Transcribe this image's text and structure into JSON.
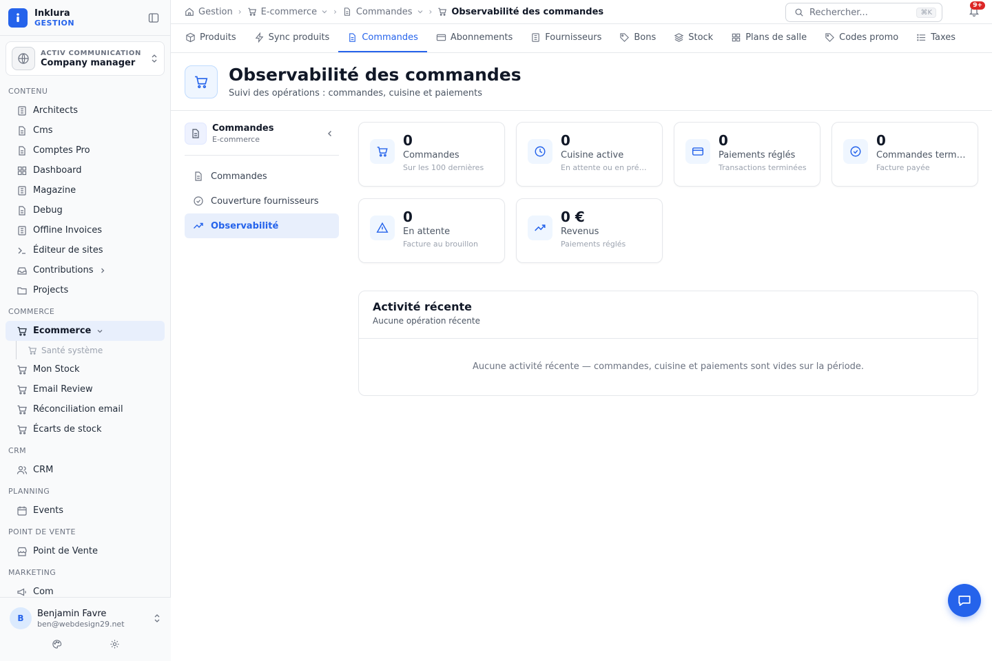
{
  "brand": {
    "name": "Inklura",
    "subtitle": "GESTION"
  },
  "company": {
    "org": "ACTIV COMMUNICATION",
    "role": "Company manager"
  },
  "sidebar": {
    "sections": [
      {
        "title": "CONTENU",
        "items": [
          "Architects",
          "Cms",
          "Comptes Pro",
          "Dashboard",
          "Magazine",
          "Debug",
          "Offline Invoices",
          "Éditeur de sites",
          "Contributions",
          "Projects"
        ]
      },
      {
        "title": "COMMERCE",
        "items": [
          "Ecommerce",
          "Santé système",
          "Mon Stock",
          "Email Review",
          "Réconciliation email",
          "Écarts de stock"
        ]
      },
      {
        "title": "CRM",
        "items": [
          "CRM"
        ]
      },
      {
        "title": "PLANNING",
        "items": [
          "Events"
        ]
      },
      {
        "title": "POINT DE VENTE",
        "items": [
          "Point de Vente"
        ]
      },
      {
        "title": "MARKETING",
        "items": [
          "Com"
        ]
      }
    ]
  },
  "user": {
    "initial": "B",
    "name": "Benjamin Favre",
    "email": "ben@webdesign29.net"
  },
  "breadcrumb": [
    "Gestion",
    "E-commerce",
    "Commandes",
    "Observabilité des commandes"
  ],
  "search": {
    "placeholder": "Rechercher...",
    "shortcut": "⌘K"
  },
  "notifications": {
    "badge": "9+"
  },
  "tabs": [
    "Produits",
    "Sync produits",
    "Commandes",
    "Abonnements",
    "Fournisseurs",
    "Bons",
    "Stock",
    "Plans de salle",
    "Codes promo",
    "Taxes"
  ],
  "page": {
    "title": "Observabilité des commandes",
    "subtitle": "Suivi des opérations : commandes, cuisine et paiements"
  },
  "subnav": {
    "title": "Commandes",
    "subtitle": "E-commerce",
    "items": [
      "Commandes",
      "Couverture fournisseurs",
      "Observabilité"
    ]
  },
  "stats": [
    {
      "value": "0",
      "label": "Commandes",
      "hint": "Sur les 100 dernières",
      "icon": "cart-icon"
    },
    {
      "value": "0",
      "label": "Cuisine active",
      "hint": "En attente ou en préparation",
      "icon": "clock-icon"
    },
    {
      "value": "0",
      "label": "Paiements réglés",
      "hint": "Transactions terminées",
      "icon": "credit-card-icon"
    },
    {
      "value": "0",
      "label": "Commandes terminées",
      "hint": "Facture payée",
      "icon": "check-circle-icon"
    },
    {
      "value": "0",
      "label": "En attente",
      "hint": "Facture au brouillon",
      "icon": "warning-icon"
    },
    {
      "value": "0 €",
      "label": "Revenus",
      "hint": "Paiements réglés",
      "icon": "trending-up-icon"
    }
  ],
  "activity": {
    "title": "Activité récente",
    "subtitle": "Aucune opération récente",
    "empty": "Aucune activité récente — commandes, cuisine et paiements sont vides sur la période."
  },
  "colors": {
    "accent": "#2563eb",
    "active_bg": "#e8effc",
    "badge": "#dc2626"
  }
}
